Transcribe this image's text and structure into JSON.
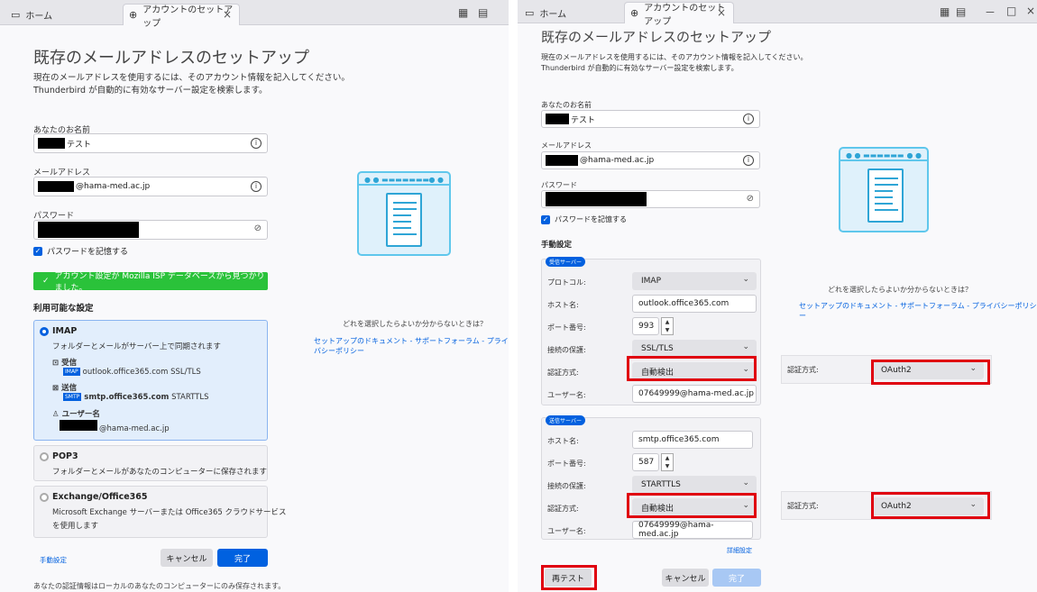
{
  "tabs": {
    "home": "ホーム",
    "setup": "アカウントのセットアップ",
    "close": "×"
  },
  "window_controls": {
    "min": "－",
    "max": "□",
    "close": "×"
  },
  "page": {
    "title": "既存のメールアドレスのセットアップ",
    "desc_line1": "現在のメールアドレスを使用するには、そのアカウント情報を記入してください。",
    "desc_line2": "Thunderbird が自動的に有効なサーバー設定を検索します。"
  },
  "form": {
    "name_label": "あなたのお名前",
    "name_value": "テスト",
    "email_label": "メールアドレス",
    "email_value": "@hama-med.ac.jp",
    "password_label": "パスワード",
    "remember_label": "パスワードを記憶する"
  },
  "left": {
    "success": "アカウント設定が Mozilla ISP データベースから見つかりました。",
    "available_title": "利用可能な設定",
    "imap": {
      "title": "IMAP",
      "desc": "フォルダーとメールがサーバー上で同期されます",
      "incoming": "受信",
      "incoming_tag": "IMAP",
      "incoming_server": "outlook.office365.com SSL/TLS",
      "outgoing": "送信",
      "outgoing_tag": "SMTP",
      "outgoing_host": "smtp.office365.com",
      "outgoing_sec": "STARTTLS",
      "user": "ユーザー名",
      "user_value": "@hama-med.ac.jp"
    },
    "pop3": {
      "title": "POP3",
      "desc": "フォルダーとメールがあなたのコンピューターに保存されます"
    },
    "exchange": {
      "title": "Exchange/Office365",
      "desc1": "Microsoft Exchange サーバーまたは Office365 クラウドサービス",
      "desc2": "を使用します"
    },
    "manual": "手動設定",
    "cancel": "キャンセル",
    "done": "完了",
    "footnote": "あなたの認証情報はローカルのあなたのコンピューターにのみ保存されます。"
  },
  "help": {
    "question": "どれを選択したらよいか分からないときは？",
    "links": "セットアップのドキュメント - サポートフォーラム - プライバシーポリシー"
  },
  "right": {
    "manual_title": "手動設定",
    "incoming_pill": "受信サーバー",
    "outgoing_pill": "送信サーバー",
    "protocol_label": "プロトコル:",
    "protocol": "IMAP",
    "host_label": "ホスト名:",
    "incoming_host": "outlook.office365.com",
    "port_label": "ポート番号:",
    "incoming_port": "993",
    "security_label": "接続の保護:",
    "incoming_security": "SSL/TLS",
    "auth_label": "認証方式:",
    "auth_value": "自動検出",
    "user_label": "ユーザー名:",
    "user_value": "07649999@hama-med.ac.jp",
    "outgoing_host": "smtp.office365.com",
    "outgoing_port": "587",
    "outgoing_security": "STARTTLS",
    "side_auth_label": "認証方式:",
    "side_auth_value": "OAuth2",
    "advanced": "詳細設定",
    "retest": "再テスト",
    "cancel": "キャンセル",
    "done": "完了"
  }
}
